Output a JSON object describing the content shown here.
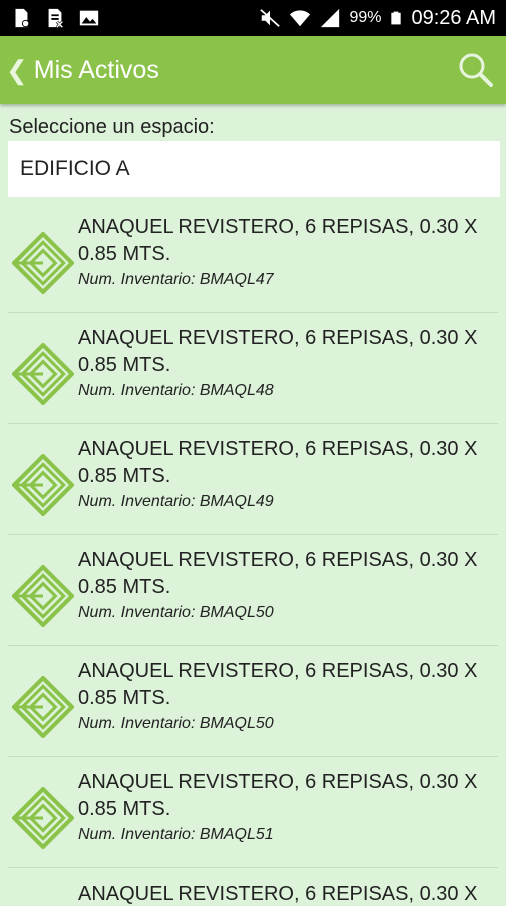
{
  "status_bar": {
    "battery": "99%",
    "time": "09:26 AM",
    "icons": [
      "sdcard-icon",
      "sim-icon",
      "image-icon",
      "mute-icon",
      "wifi-icon",
      "signal-icon",
      "battery-icon"
    ]
  },
  "app_bar": {
    "back_icon": "chevron-left-icon",
    "title": "Mis Activos",
    "search_icon": "search-icon"
  },
  "space_picker": {
    "label": "Seleccione un espacio:",
    "selected": "EDIFICIO A"
  },
  "assets": [
    {
      "name": "ANAQUEL REVISTERO, 6 REPISAS, 0.30 X 0.85 MTS.",
      "inventory": "Num. Inventario: BMAQL47"
    },
    {
      "name": "ANAQUEL REVISTERO, 6 REPISAS, 0.30 X 0.85 MTS.",
      "inventory": "Num. Inventario: BMAQL48"
    },
    {
      "name": "ANAQUEL REVISTERO, 6 REPISAS, 0.30 X 0.85 MTS.",
      "inventory": "Num. Inventario: BMAQL49"
    },
    {
      "name": "ANAQUEL REVISTERO, 6 REPISAS, 0.30 X 0.85 MTS.",
      "inventory": "Num. Inventario: BMAQL50"
    },
    {
      "name": "ANAQUEL REVISTERO, 6 REPISAS, 0.30 X 0.85 MTS.",
      "inventory": "Num. Inventario: BMAQL50"
    },
    {
      "name": "ANAQUEL REVISTERO, 6 REPISAS, 0.30 X 0.85 MTS.",
      "inventory": "Num. Inventario: BMAQL51"
    }
  ],
  "partial_item": "ANAQUEL REVISTERO, 6 REPISAS, 0.30 X",
  "colors": {
    "app_bar": "#8bc34a",
    "background": "#dcf3d9",
    "logo": "#8bc34a"
  }
}
